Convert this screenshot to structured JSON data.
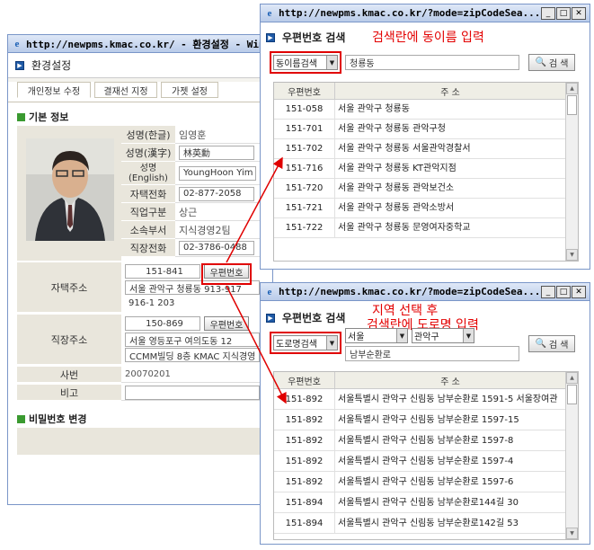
{
  "settings_window": {
    "title": "http://newpms.kmac.co.kr/ - 환경설정 - Win",
    "page_title": "환경설정",
    "tabs": [
      "개인정보 수정",
      "결재선 지정",
      "가젯 설정"
    ],
    "section_basic": "기본 정보",
    "fields": {
      "name_kr_label": "성명(한글)",
      "name_kr": "임영훈",
      "name_cn_label": "성명(漢字)",
      "name_cn": "林英勳",
      "name_en_label": "성명\n(English)",
      "name_en": "YoungHoon Yim",
      "home_phone_label": "자택전화",
      "home_phone": "02-877-2058",
      "job_label": "직업구분",
      "job": "상근",
      "dept_label": "소속부서",
      "dept": "지식경영2팀",
      "work_phone_label": "직장전화",
      "work_phone": "02-3786-0488",
      "home_addr_label": "자택주소",
      "home_zip": "151-841",
      "zip_button": "우편번호",
      "home_addr1": "서울 관악구 청룡동 913-917",
      "home_addr2": "916-1 203",
      "work_addr_label": "직장주소",
      "work_zip": "150-869",
      "work_zip_button": "우편번호",
      "work_addr1": "서울 영등포구 여의도동 12",
      "work_addr2": "CCMM빌딩 8층 KMAC 지식경영",
      "emp_no_label": "사번",
      "emp_no": "20070201",
      "note_label": "비고",
      "note": ""
    },
    "section_password": "비밀번호 변경"
  },
  "zip_window_top": {
    "title": "http://newpms.kmac.co.kr/?mode=zipCodeSea...",
    "header": "우편번호 검색",
    "annotation": "검색란에 동이름 입력",
    "search_type": "동이름검색",
    "search_value": "청룡동",
    "search_button": "검 색",
    "col_zip": "우편번호",
    "col_addr": "주 소",
    "rows": [
      {
        "zip": "151-058",
        "addr": "서울 관악구 청룡동"
      },
      {
        "zip": "151-701",
        "addr": "서울 관악구 청룡동 관악구청"
      },
      {
        "zip": "151-702",
        "addr": "서울 관악구 청룡동 서울관악경찰서"
      },
      {
        "zip": "151-716",
        "addr": "서울 관악구 청룡동 KT관악지점"
      },
      {
        "zip": "151-720",
        "addr": "서울 관악구 청룡동 관악보건소"
      },
      {
        "zip": "151-721",
        "addr": "서울 관악구 청룡동 관악소방서"
      },
      {
        "zip": "151-722",
        "addr": "서울 관악구 청룡동 문영여자중학교"
      }
    ]
  },
  "zip_window_bottom": {
    "title": "http://newpms.kmac.co.kr/?mode=zipCodeSea...",
    "header": "우편번호 검색",
    "annotation_line1": "지역 선택 후",
    "annotation_line2": "검색란에 도로명 입력",
    "search_type": "도로명검색",
    "city": "서울",
    "district": "관악구",
    "search_value": "남부순환로",
    "search_button": "검 색",
    "col_zip": "우편번호",
    "col_addr": "주 소",
    "rows": [
      {
        "zip": "151-892",
        "addr": "서울특별시 관악구 신림동 남부순환로 1591-5 서울장여관"
      },
      {
        "zip": "151-892",
        "addr": "서울특별시 관악구 신림동 남부순환로 1597-15"
      },
      {
        "zip": "151-892",
        "addr": "서울특별시 관악구 신림동 남부순환로 1597-8"
      },
      {
        "zip": "151-892",
        "addr": "서울특별시 관악구 신림동 남부순환로 1597-4"
      },
      {
        "zip": "151-892",
        "addr": "서울특별시 관악구 신림동 남부순환로 1597-6"
      },
      {
        "zip": "151-894",
        "addr": "서울특별시 관악구 신림동 남부순환로144길 30"
      },
      {
        "zip": "151-894",
        "addr": "서울특별시 관악구 신림동 남부순환로142길 53"
      }
    ]
  },
  "colors": {
    "annotation": "#e30000",
    "title_bar": "#b9cbe9",
    "label_bg": "#e9e6dc"
  }
}
